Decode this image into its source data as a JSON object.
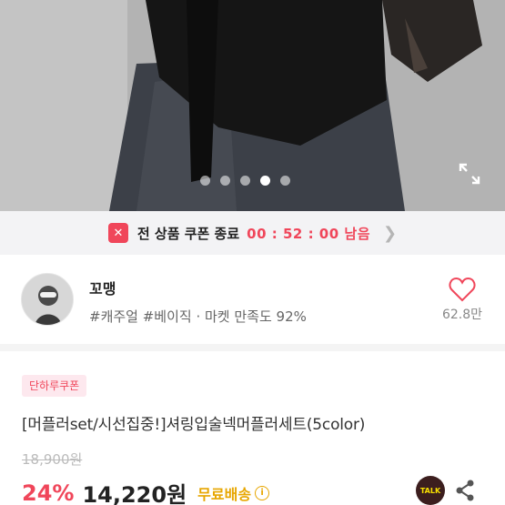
{
  "hero": {
    "image_alt": "product photo",
    "slide_count": 5,
    "active_slide": 4
  },
  "coupon_bar": {
    "badge": "✕",
    "text": "전 상품 쿠폰 종료",
    "timer": "00 : 52 : 00 남음",
    "chevron": "❯"
  },
  "seller": {
    "name": "꼬맹",
    "tags": "#캐주얼 #베이직 · 마켓 만족도 92%",
    "likes": "62.8만"
  },
  "product": {
    "coupon_badge": "단하루쿠폰",
    "title": "[머플러set/시선집중!]셔링입술넥머플러세트(5color)",
    "original_price": "18,900원",
    "discount": "24%",
    "price": "14,220원",
    "shipping": "무료배송",
    "info_icon": "i",
    "talk_label": "TALK"
  },
  "colors": {
    "accent": "#f0465a",
    "shipping": "#e7a600",
    "kakao_bg": "#3c1e1e",
    "kakao_text": "#fae100"
  },
  "icons": [
    "expand-icon",
    "heart-icon",
    "kakao-talk-icon",
    "share-icon",
    "info-icon",
    "chevron-right-icon"
  ]
}
